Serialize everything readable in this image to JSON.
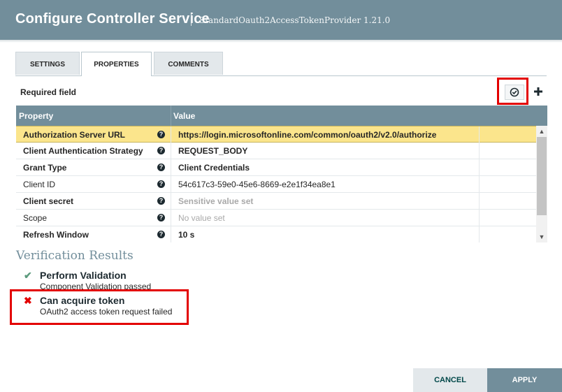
{
  "dialog": {
    "title": "Configure Controller Service",
    "subtitle": "StandardOauth2AccessTokenProvider 1.21.0"
  },
  "tabs": [
    {
      "label": "SETTINGS",
      "active": false
    },
    {
      "label": "PROPERTIES",
      "active": true
    },
    {
      "label": "COMMENTS",
      "active": false
    }
  ],
  "required_field_label": "Required field",
  "toolbar": {
    "verify_icon": "check-circle-icon",
    "add_icon": "plus-icon"
  },
  "grid": {
    "headers": {
      "property": "Property",
      "value": "Value"
    },
    "rows": [
      {
        "name": "Authorization Server URL",
        "value": "https://login.microsoftonline.com/common/oauth2/v2.0/authorize"
      },
      {
        "name": "Client Authentication Strategy",
        "value": "REQUEST_BODY"
      },
      {
        "name": "Grant Type",
        "value": "Client Credentials"
      },
      {
        "name": "Client ID",
        "value": "54c617c3-59e0-45e6-8669-e2e1f34ea8e1"
      },
      {
        "name": "Client secret",
        "value": "Sensitive value set"
      },
      {
        "name": "Scope",
        "value": "No value set"
      },
      {
        "name": "Refresh Window",
        "value": "10 s"
      }
    ],
    "help_glyph": "?"
  },
  "verification": {
    "title": "Verification Results",
    "results": [
      {
        "title": "Perform Validation",
        "detail": "Component Validation passed",
        "status": "success"
      },
      {
        "title": "Can acquire token",
        "detail": "OAuth2 access token request failed",
        "status": "failure"
      }
    ]
  },
  "footer": {
    "cancel_label": "CANCEL",
    "apply_label": "APPLY"
  },
  "colors": {
    "header": "#728e9b",
    "selected_row": "#fbe58c",
    "success": "#5b9a7c",
    "failure": "#e30000",
    "highlight_box": "#e30000"
  }
}
